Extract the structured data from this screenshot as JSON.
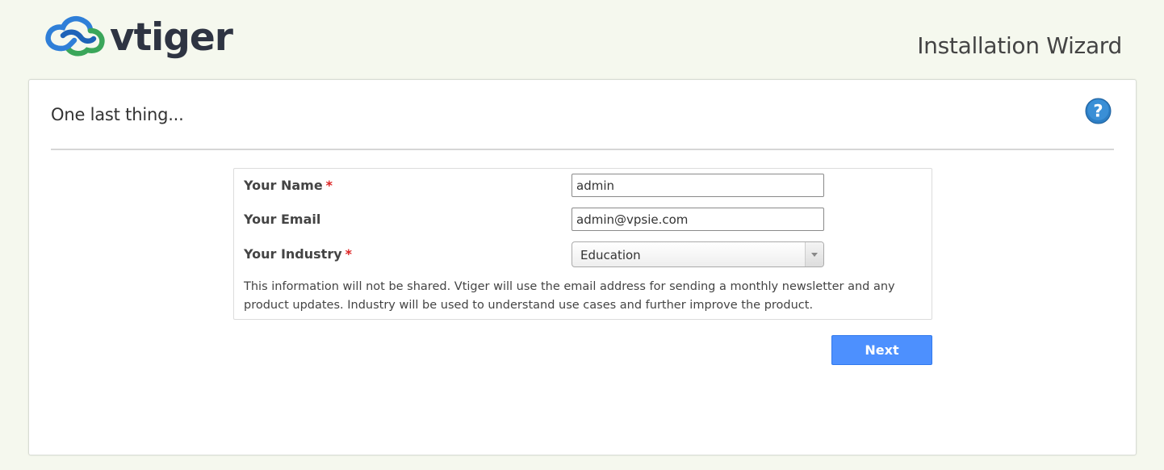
{
  "header": {
    "logo_text": "vtiger",
    "wizard_title": "Installation Wizard"
  },
  "panel": {
    "title": "One last thing..."
  },
  "form": {
    "name_label": "Your Name",
    "name_value": "admin",
    "email_label": "Your Email",
    "email_value": "admin@vpsie.com",
    "industry_label": "Your Industry",
    "industry_value": "Education",
    "required_marker": "*",
    "note": "This information will not be shared. Vtiger will use the email address for sending a monthly newsletter and any product updates. Industry will be used to understand use cases and further improve the product."
  },
  "actions": {
    "next_label": "Next"
  },
  "colors": {
    "background": "#f5f8ee",
    "primary_button": "#4d90fe",
    "required": "#dd2222",
    "help_icon": "#2d7ec4"
  }
}
